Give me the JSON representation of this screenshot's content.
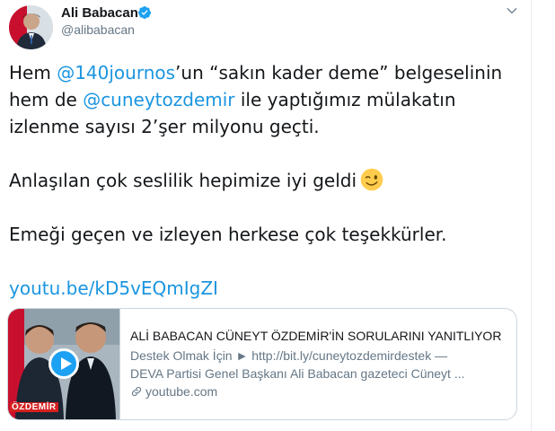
{
  "author": {
    "name": "Ali Babacan",
    "handle": "@alibabacan"
  },
  "tweet": {
    "line1": {
      "prefix": "Hem ",
      "mention1": "@140journos",
      "middle": "’un “sakın kader deme” belgeselinin"
    },
    "line2": {
      "prefix": "hem de ",
      "mention2": "@cuneytozdemir",
      "suffix": " ile yaptığımız mülakatın"
    },
    "line3": "izlenme sayısı 2’şer milyonu geçti.",
    "line4": "Anlaşılan çok seslilik hepimize iyi geldi",
    "line5": "Emeği geçen ve izleyen herkese çok teşekkürler.",
    "url": "youtu.be/kD5vEQmIgZI"
  },
  "card": {
    "title": "ALİ BABACAN CÜNEYT ÖZDEMİR'İN SORULARINI YANITLIYOR",
    "desc_line1": "Destek Olmak İçin ► http://bit.ly/cuneytozdemirdestek —",
    "desc_line2": "DEVA Partisi Genel Başkanı Ali Babacan gazeteci Cüneyt ...",
    "domain": "youtube.com",
    "thumb_caption": "ÖZDEMİR"
  },
  "colors": {
    "link": "#1b95e0",
    "secondary_text": "#657786",
    "verified": "#1da1f2",
    "border": "#ccd6dd"
  },
  "icons": {
    "verified": "verified-badge-icon",
    "caret": "chevron-down-icon",
    "emoji": "winking-face-emoji",
    "play": "play-icon",
    "link": "link-icon"
  }
}
